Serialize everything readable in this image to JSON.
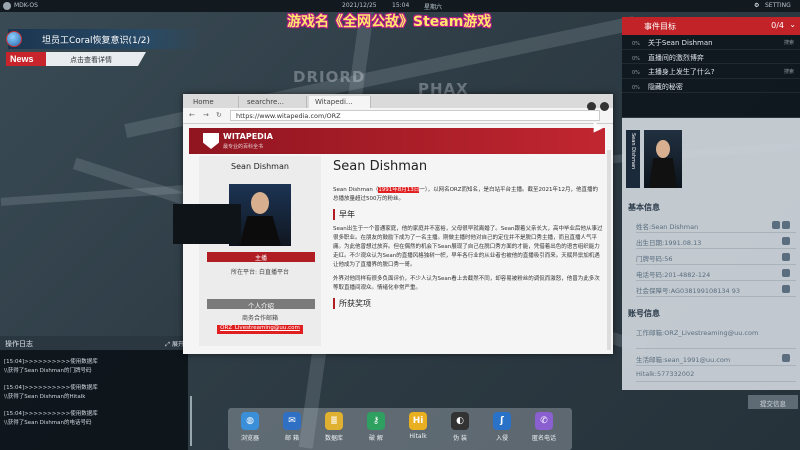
{
  "topbar": {
    "os_name": "MDK-OS",
    "date": "2021/12/25",
    "time": "15:04",
    "weekday": "星期六",
    "settings_label": "SETTING"
  },
  "stream_title": "游戏名《全网公敌》Steam游戏",
  "map_labels": [
    "DRIORD",
    "PHAX"
  ],
  "news": {
    "headline": "坦员工Coral恢复意识(1/2)",
    "tag": "News",
    "link": "点击查看详情"
  },
  "oplog": {
    "title": "操作日志",
    "expand_label": "展开",
    "entries": [
      "[15:04]>>>>>>>>>>使用数据库",
      "\\\\获得了Sean Dishman的门牌号码",
      "[15:04]>>>>>>>>>>使用数据库",
      "\\\\获得了Sean Dishman的Hitalk",
      "[15:04]>>>>>>>>>>使用数据库",
      "\\\\获得了Sean Dishman的电话号码"
    ]
  },
  "dock": [
    {
      "label": "浏览器",
      "icon": "browser-icon",
      "color": "#3b8ed8"
    },
    {
      "label": "邮 箱",
      "icon": "mail-icon",
      "color": "#2f6fc4"
    },
    {
      "label": "数据库",
      "icon": "database-icon",
      "color": "#e0b030"
    },
    {
      "label": "破 解",
      "icon": "crack-icon",
      "color": "#2ea060"
    },
    {
      "label": "Hitalk",
      "icon": "hitalk-icon",
      "color": "#e8b020"
    },
    {
      "label": "伪 装",
      "icon": "disguise-icon",
      "color": "#333"
    },
    {
      "label": "入侵",
      "icon": "hack-icon",
      "color": "#2a72c8"
    },
    {
      "label": "匿名电话",
      "icon": "phone-icon",
      "color": "#8a60d0"
    }
  ],
  "events": {
    "title": "事件目标",
    "count": "0/4",
    "items": [
      {
        "pct": "0%",
        "text": "关于Sean Dishman",
        "tail": "搜索"
      },
      {
        "pct": "0%",
        "text": "直播间的激烈博弈",
        "tail": ""
      },
      {
        "pct": "0%",
        "text": "主播身上发生了什么?",
        "tail": "搜索"
      },
      {
        "pct": "0%",
        "text": "隐藏的秘密",
        "tail": ""
      }
    ]
  },
  "profile": {
    "name_strip": "Sean Dishman",
    "basic_title": "基本信息",
    "basic": [
      "姓名:Sean Dishman",
      "出生日期:1991.08.13",
      "门牌号码:56",
      "电话号码:201-4882-124",
      "社会保障号:AG038199108134 93"
    ],
    "account_title": "账号信息",
    "accounts": [
      "工作邮箱:ORZ_Livestreaming@uu.com",
      "生活邮箱:sean_1991@uu.com",
      "Hitalk:577332002"
    ],
    "submit_label": "提交信息"
  },
  "browser": {
    "tabs": [
      "Home",
      "searchre...",
      "Witapedi..."
    ],
    "url": "https://www.witapedia.com/ORZ",
    "wiki_name": "WITAPEDIA",
    "wiki_tagline": "最专业的百科全书",
    "infobox": {
      "name": "Sean Dishman",
      "role": "主播",
      "platform": "所在平台: 白直播平台",
      "intro_label": "个人介绍",
      "mail_label": "商务合作邮箱",
      "mail": "ORZ_Livestreaming@uu.com"
    },
    "article": {
      "title": "Sean Dishman",
      "p1_a": "Sean Dishman（",
      "p1_hl": "1991年8月13日",
      "p1_b": "一），以网名ORZ而知名，是白站平台主播。截至2021年12月，他直播的总播放量超过500万的粉丝。",
      "sec1": "早年",
      "p2": "Sean出生于一个普通家庭，他的家庭并不富裕，父母很早就离婚了。Sean跟着父亲长大，高中毕业后他从事过很多职业。在朋友的鼓励下成为了一名主播。刚做主播时他对自己的定位并不是脱口秀主播，而且直播人气平庸。为此他曾想过放弃。但在偶然的机会下Sean展现了自己在脱口秀方面的才能，凭借着出色的语言组织能力走红。不少观众认为Sean的直播风格独树一帜，早年各行业的从业者也被他的直播吸引而来。天赋异禀加机遇让他成为了直播界的脱口秀一哥。",
      "p3": "外界对他同样有很多负面评价，不少人认为Sean看上去截然不同，却容易被粉丝的调侃而激怒，他曾为此多次等取直播间观众。情绪化非常严重。",
      "sec2": "所获奖项"
    }
  }
}
